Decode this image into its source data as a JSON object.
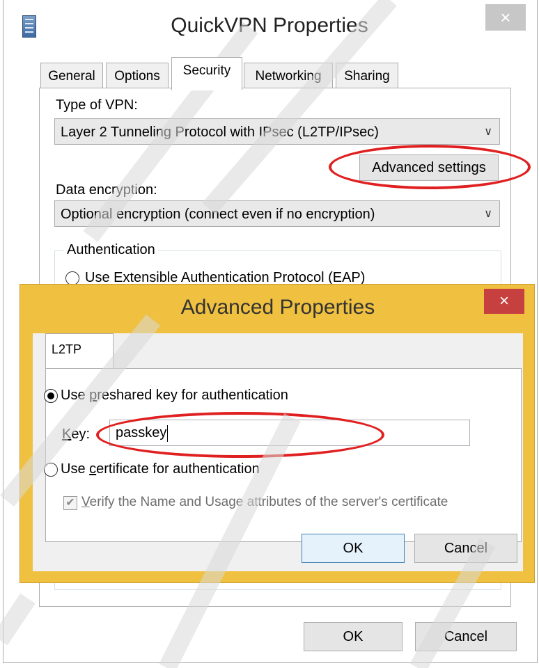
{
  "back_window": {
    "title": "QuickVPN Properties",
    "close_glyph": "×",
    "tabs": [
      {
        "label": "General"
      },
      {
        "label": "Options"
      },
      {
        "label": "Security"
      },
      {
        "label": "Networking"
      },
      {
        "label": "Sharing"
      }
    ],
    "active_tab": "Security",
    "vpn_type_label": "Type of VPN:",
    "vpn_type_value": "Layer 2 Tunneling Protocol with IPsec (L2TP/IPsec)",
    "advanced_settings_label": "Advanced settings",
    "data_encryption_label": "Data encryption:",
    "data_encryption_value": "Optional encryption (connect even if no encryption)",
    "authentication_group_label": "Authentication",
    "eap_radio_label": "Use Extensible Authentication Protocol (EAP)",
    "ok_label": "OK",
    "cancel_label": "Cancel"
  },
  "advanced_dialog": {
    "title": "Advanced Properties",
    "close_glyph": "×",
    "tab_label": "L2TP",
    "preshared_radio": {
      "label_prefix": "Use ",
      "label_underlined": "p",
      "label_rest": "reshared key for authentication",
      "checked": true
    },
    "key_label_underlined": "K",
    "key_label_rest": "ey:",
    "key_value": "passkey",
    "certificate_radio": {
      "label_prefix": "Use ",
      "label_underlined": "c",
      "label_rest": "ertificate for authentication",
      "checked": false
    },
    "verify_checkbox": {
      "label_underlined": "V",
      "label_rest": "erify the Name and Usage attributes of the server's certificate",
      "checked": true,
      "disabled": true
    },
    "ok_label": "OK",
    "cancel_label": "Cancel"
  },
  "colors": {
    "active_frame": "#f0c040",
    "close_active": "#c74040",
    "highlight_ellipse": "#e02020"
  },
  "icons": {
    "window_icon": "network-connection-icon",
    "combo_arrow": "chevron-down-icon",
    "checkmark": "check-icon"
  }
}
